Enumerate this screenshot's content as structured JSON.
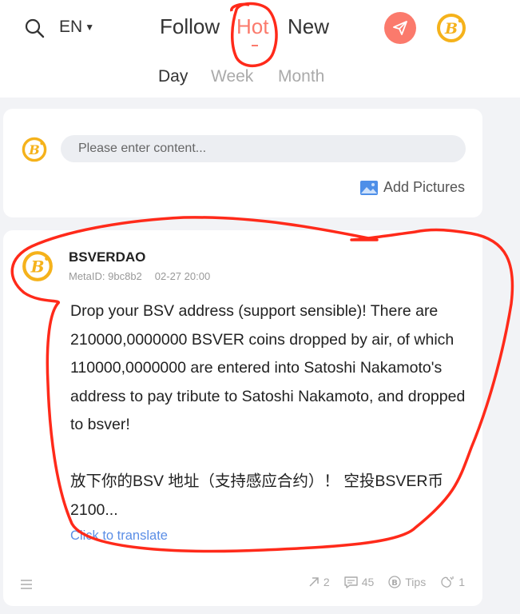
{
  "header": {
    "language": "EN",
    "tabs": [
      "Follow",
      "Hot",
      "New"
    ],
    "active_tab": "Hot",
    "period_tabs": [
      "Day",
      "Week",
      "Month"
    ],
    "active_period": "Day",
    "accent_color": "#fb7a6c"
  },
  "composer": {
    "placeholder": "Please enter content...",
    "add_pictures": "Add Pictures"
  },
  "post": {
    "author": "BSVERDAO",
    "metaid": "MetaID: 9bc8b2",
    "time": "02-27 20:00",
    "content": "Drop your BSV address (support sensible)! There are 210000,0000000 BSVER coins dropped by air, of which 110000,0000000 are entered into Satoshi Nakamoto's address to pay tribute to Satoshi Nakamoto, and dropped to bsver!\n\n放下你的BSV 地址（支持感应合约）！ 空投BSVER币 2100...",
    "translate": "Click to translate",
    "reposts": "2",
    "comments": "45",
    "tips": "Tips",
    "likes": "1"
  }
}
